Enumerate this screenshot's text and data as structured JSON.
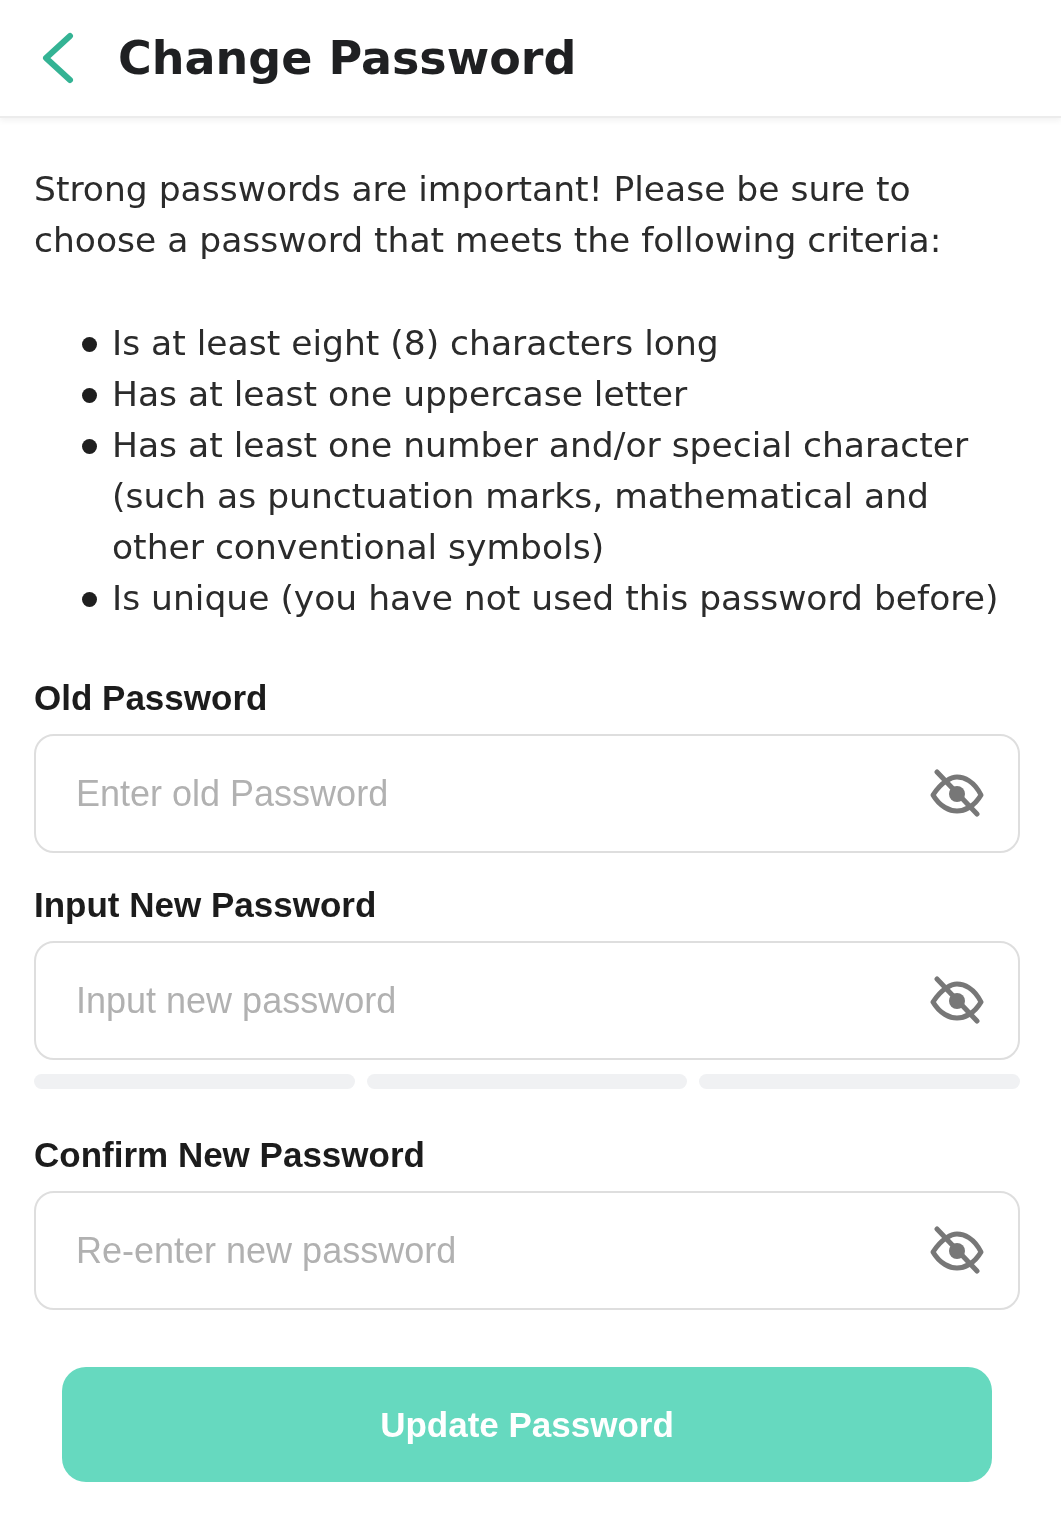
{
  "header": {
    "title": "Change Password"
  },
  "intro": "Strong passwords are important! Please be sure to choose a password that meets the following criteria:",
  "criteria": [
    "Is at least eight (8) characters long",
    "Has at least one uppercase letter",
    "Has at least one number and/or special character (such as punctuation marks, mathematical and other conventional symbols)",
    "Is unique (you have not used this password before)"
  ],
  "fields": [
    {
      "label": "Old Password",
      "placeholder": "Enter old Password",
      "visible": false
    },
    {
      "label": "Input New Password",
      "placeholder": "Input new password",
      "visible": false,
      "strength_meter": {
        "level": 0
      }
    },
    {
      "label": "Confirm New Password",
      "placeholder": "Re-enter new password",
      "visible": false
    }
  ],
  "submit": {
    "label": "Update Password",
    "disabled": true
  }
}
